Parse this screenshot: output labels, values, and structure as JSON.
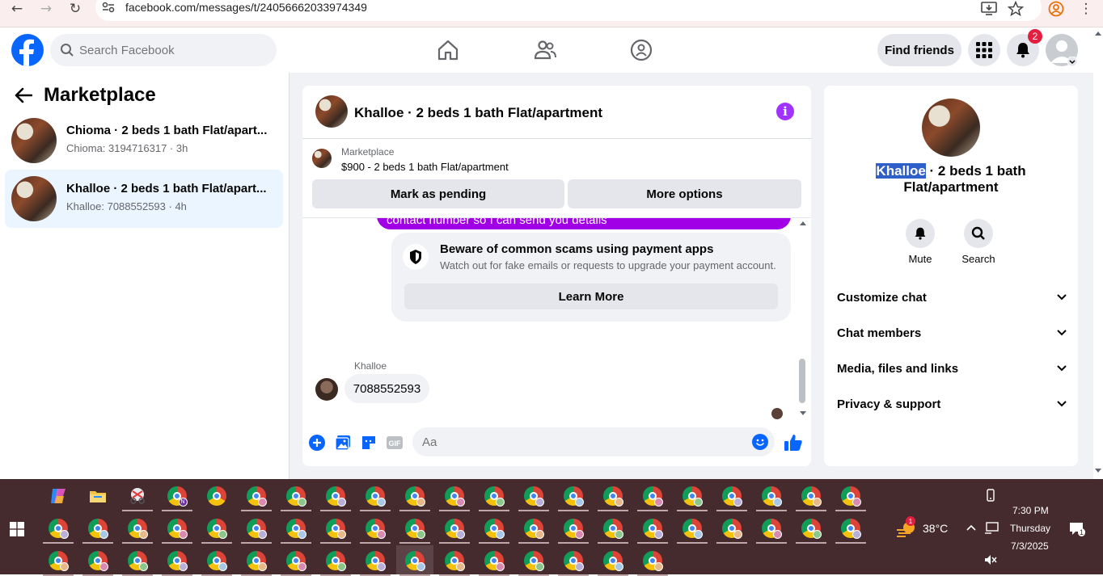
{
  "browser": {
    "url": "facebook.com/messages/t/24056662033974349"
  },
  "header": {
    "search_placeholder": "Search Facebook",
    "find_friends": "Find friends",
    "notification_count": "2"
  },
  "sidebar": {
    "title": "Marketplace",
    "conversations": [
      {
        "title": "Chioma · 2 beds 1 bath Flat/apart...",
        "subtitle": "Chioma: 3194716317 · 3h"
      },
      {
        "title": "Khalloe · 2 beds 1 bath Flat/apart...",
        "subtitle": "Khalloe: 7088552593 · 4h"
      }
    ]
  },
  "chat": {
    "title": "Khalloe · 2 beds 1 bath Flat/apartment",
    "info_glyph": "i",
    "listing": {
      "source": "Marketplace",
      "price_title": "$900 - 2 beds 1 bath Flat/apartment",
      "mark_pending": "Mark as pending",
      "more_options": "More options"
    },
    "partial_message": "contact number so I can send you details",
    "scam_warning": {
      "title": "Beware of common scams using payment apps",
      "description": "Watch out for fake emails or requests to upgrade your payment account.",
      "button": "Learn More"
    },
    "sender_name": "Khalloe",
    "phone_message": "7088552593",
    "input_placeholder": "Aa"
  },
  "info_panel": {
    "name_highlight": "Khalloe",
    "name_rest": " · 2 beds 1 bath",
    "name_line2": "Flat/apartment",
    "actions": [
      {
        "label": "Mute",
        "icon": "bell-icon"
      },
      {
        "label": "Search",
        "icon": "search-icon"
      }
    ],
    "sections": [
      "Customize chat",
      "Chat members",
      "Media, files and links",
      "Privacy & support"
    ]
  },
  "taskbar": {
    "weather_temp": "38°C",
    "weather_badge": "1",
    "time": "7:30 PM",
    "day": "Thursday",
    "date": "7/3/2025",
    "notification_count": "1",
    "pinned_app_badge": "N"
  },
  "colors": {
    "facebook_blue": "#0866ff",
    "messenger_purple": "#a100e6",
    "info_purple": "#a033ff",
    "notification_red": "#e41e3f",
    "taskbar_bg": "#452a2e"
  }
}
